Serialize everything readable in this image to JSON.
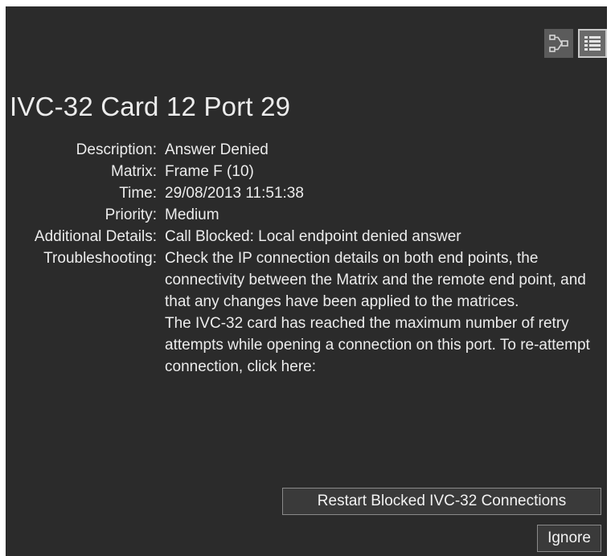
{
  "toolbar": {
    "icons": [
      "flow-diagram-icon",
      "list-view-icon"
    ]
  },
  "alarm": {
    "title": "IVC-32 Card 12 Port 29",
    "fields": [
      {
        "label": "Description:",
        "value": "Answer Denied"
      },
      {
        "label": "Matrix:",
        "value": "Frame F (10)"
      },
      {
        "label": "Time:",
        "value": "29/08/2013 11:51:38"
      },
      {
        "label": "Priority:",
        "value": "Medium"
      },
      {
        "label": "Additional Details:",
        "value": "Call Blocked: Local endpoint denied answer"
      },
      {
        "label": "Troubleshooting:",
        "paragraphs": [
          "Check the IP connection details on both end points, the connectivity between the Matrix and the remote end point, and that any changes have been applied to the matrices.",
          "The IVC-32 card has reached the maximum number of retry attempts while opening a connection on this port. To re-attempt connection, click here:"
        ]
      }
    ]
  },
  "actions": {
    "restart_label": "Restart Blocked IVC-32 Connections",
    "ignore_label": "Ignore"
  }
}
